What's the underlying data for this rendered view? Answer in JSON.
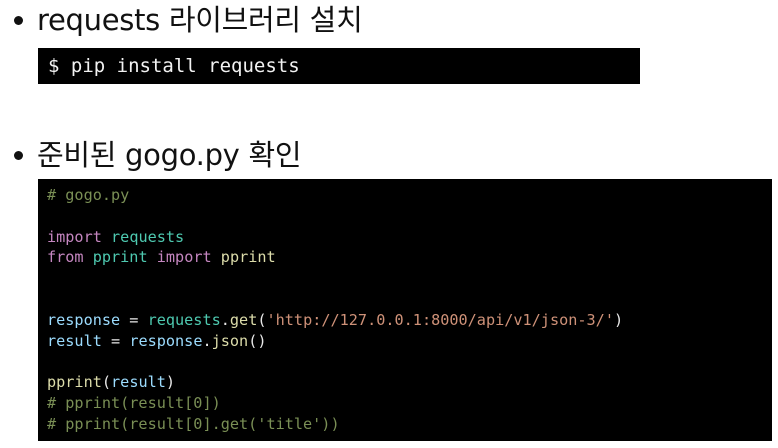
{
  "section1": {
    "heading": "requests 라이브러리 설치",
    "command": "$ pip install requests"
  },
  "section2": {
    "heading": "준비된 gogo.py 확인",
    "code_lines": [
      [
        {
          "t": "# gogo.py",
          "k": "comment"
        }
      ],
      [],
      [
        {
          "t": "import",
          "k": "keyword"
        },
        {
          "t": " ",
          "k": "plain"
        },
        {
          "t": "requests",
          "k": "module"
        }
      ],
      [
        {
          "t": "from",
          "k": "keyword"
        },
        {
          "t": " ",
          "k": "plain"
        },
        {
          "t": "pprint",
          "k": "module"
        },
        {
          "t": " ",
          "k": "plain"
        },
        {
          "t": "import",
          "k": "keyword"
        },
        {
          "t": " ",
          "k": "plain"
        },
        {
          "t": "pprint",
          "k": "func"
        }
      ],
      [],
      [],
      [
        {
          "t": "response",
          "k": "var"
        },
        {
          "t": " = ",
          "k": "plain"
        },
        {
          "t": "requests",
          "k": "module"
        },
        {
          "t": ".",
          "k": "plain"
        },
        {
          "t": "get",
          "k": "func"
        },
        {
          "t": "(",
          "k": "plain"
        },
        {
          "t": "'http://127.0.0.1:8000/api/v1/json-3/'",
          "k": "string"
        },
        {
          "t": ")",
          "k": "plain"
        }
      ],
      [
        {
          "t": "result",
          "k": "var"
        },
        {
          "t": " = ",
          "k": "plain"
        },
        {
          "t": "response",
          "k": "var"
        },
        {
          "t": ".",
          "k": "plain"
        },
        {
          "t": "json",
          "k": "func"
        },
        {
          "t": "()",
          "k": "plain"
        }
      ],
      [],
      [
        {
          "t": "pprint",
          "k": "func"
        },
        {
          "t": "(",
          "k": "plain"
        },
        {
          "t": "result",
          "k": "var"
        },
        {
          "t": ")",
          "k": "plain"
        }
      ],
      [
        {
          "t": "# pprint(result[0])",
          "k": "comment"
        }
      ],
      [
        {
          "t": "# pprint(result[0].get('title'))",
          "k": "comment"
        }
      ]
    ]
  },
  "colors": {
    "comment": "#7a8f55",
    "keyword": "#c586c0",
    "module": "#4ec9b0",
    "func": "#dcdcaa",
    "var": "#9cdcfe",
    "string": "#ce9178",
    "plain": "#e8e8e8",
    "code_background": "#000000"
  }
}
